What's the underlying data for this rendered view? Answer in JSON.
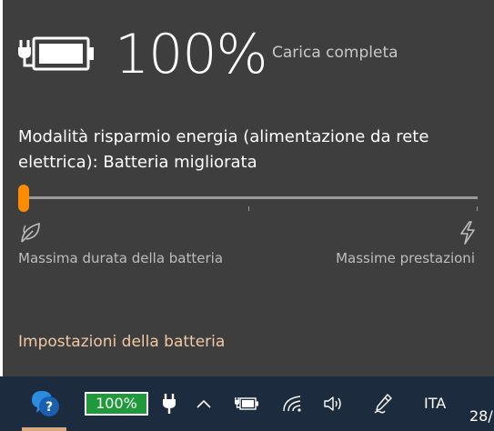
{
  "battery": {
    "percent_text": "100%",
    "status": "Carica completa",
    "icon": "battery-plugged-full-icon"
  },
  "power_mode": {
    "title": "Modalità risparmio energia (alimentazione da rete elettrica): Batteria migliorata",
    "slider_level": 0,
    "min_label": "Massima durata della batteria",
    "max_label": "Massime prestazioni",
    "min_icon": "leaf-icon",
    "max_icon": "lightning-icon"
  },
  "settings_link": "Impostazioni della batteria",
  "taskbar": {
    "battery_badge": "100%",
    "language": "ITA",
    "clock": "28/",
    "icons": [
      "help-chat-icon",
      "plug-icon",
      "chevron-up-icon",
      "battery-icon",
      "wifi-icon",
      "volume-icon",
      "pen-icon"
    ]
  },
  "colors": {
    "flyout_bg": "#3e3e3e",
    "accent": "#ff8c00",
    "link": "#f0c8a4",
    "taskbar_bg": "#1c2b3d",
    "battery_badge_bg": "#1e9a3a"
  }
}
